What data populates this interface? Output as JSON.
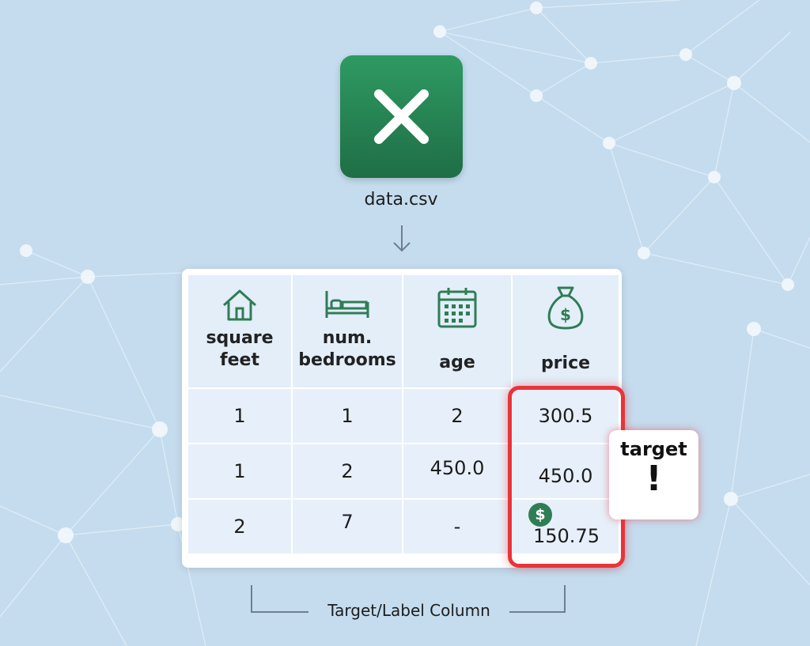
{
  "colors": {
    "background": "#c4dcee",
    "accent_green": "#2e9a62",
    "highlight_red": "#e8343a"
  },
  "file": {
    "icon": "spreadsheet-x-icon",
    "name": "data.csv"
  },
  "table": {
    "columns": [
      {
        "icon": "house-icon",
        "label": "square\nfeet"
      },
      {
        "icon": "bed-icon",
        "label": "num.\nbedrooms"
      },
      {
        "icon": "calendar-icon",
        "label": "age"
      },
      {
        "icon": "money-bag-icon",
        "label": "price"
      }
    ],
    "rows": [
      [
        "1",
        "1",
        "2",
        "300.5"
      ],
      [
        "1",
        "2",
        "450.0",
        "450.0"
      ],
      [
        "2",
        "7",
        "-",
        "150.75"
      ]
    ]
  },
  "target_callout": {
    "text": "target",
    "mark": "!"
  },
  "bracket_label": "Target/Label Column"
}
